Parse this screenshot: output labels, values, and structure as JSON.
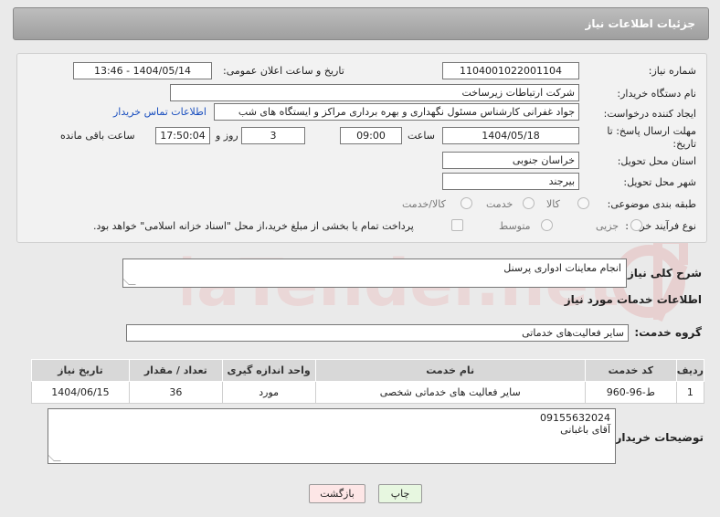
{
  "header": {
    "title": "جزئیات اطلاعات نیاز"
  },
  "form": {
    "need_number_label": "شماره نیاز:",
    "need_number": "1104001022001104",
    "announce_label": "تاریخ و ساعت اعلان عمومی:",
    "announce_value": "1404/05/14 - 13:46",
    "buyer_org_label": "نام دستگاه خریدار:",
    "buyer_org": "شرکت ارتباطات زیرساخت",
    "creator_label": "ایجاد کننده درخواست:",
    "creator": "جواد غفرانی کارشناس مسئول نگهداری و بهره برداری مراکز و ایستگاه های شب",
    "contact_link": "اطلاعات تماس خریدار",
    "deadline_label_1": "مهلت ارسال پاسخ: تا",
    "deadline_label_2": "تاریخ:",
    "deadline_date": "1404/05/18",
    "time_label": "ساعت",
    "deadline_time": "09:00",
    "days_value": "3",
    "days_label": "روز و",
    "remaining_time": "17:50:04",
    "remaining_label": "ساعت باقی مانده",
    "province_label": "استان محل تحویل:",
    "province": "خراسان جنوبی",
    "city_label": "شهر محل تحویل:",
    "city": "بیرجند",
    "category_label": "طبقه بندی موضوعی:",
    "category_options": [
      "کالا",
      "خدمت",
      "کالا/خدمت"
    ],
    "process_label": "نوع فرآیند خرید :",
    "process_options": [
      "جزیی",
      "متوسط"
    ],
    "payment_note": "پرداخت تمام یا بخشی از مبلغ خرید،از محل \"اسناد خزانه اسلامی\" خواهد بود."
  },
  "summary": {
    "label": "شرح کلی نیاز:",
    "value": "انجام معاینات ادواری پرسنل"
  },
  "services": {
    "section_title": "اطلاعات خدمات مورد نیاز",
    "group_label": "گروه خدمت:",
    "group_value": "سایر فعالیت‌های خدماتی",
    "columns": [
      "ردیف",
      "کد خدمت",
      "نام خدمت",
      "واحد اندازه گیری",
      "تعداد / مقدار",
      "تاریخ نیاز"
    ],
    "rows": [
      [
        "1",
        "ط-96-960",
        "سایر فعالیت های خدماتی شخصی",
        "مورد",
        "36",
        "1404/06/15"
      ]
    ]
  },
  "buyer_notes": {
    "label": "توضیحات خریدار:",
    "line1": "09155632024",
    "line2": "آقای باغبانی"
  },
  "buttons": {
    "print": "چاپ",
    "back": "بازگشت"
  },
  "watermark": {
    "text": "AriaTender.net"
  },
  "colors": {
    "header_bg": "#a9a9a9",
    "link": "#1a4fbf",
    "back_button_bg": "#fde6e6",
    "print_button_bg": "#e7f7e0",
    "watermark": "#e9c9c9"
  }
}
